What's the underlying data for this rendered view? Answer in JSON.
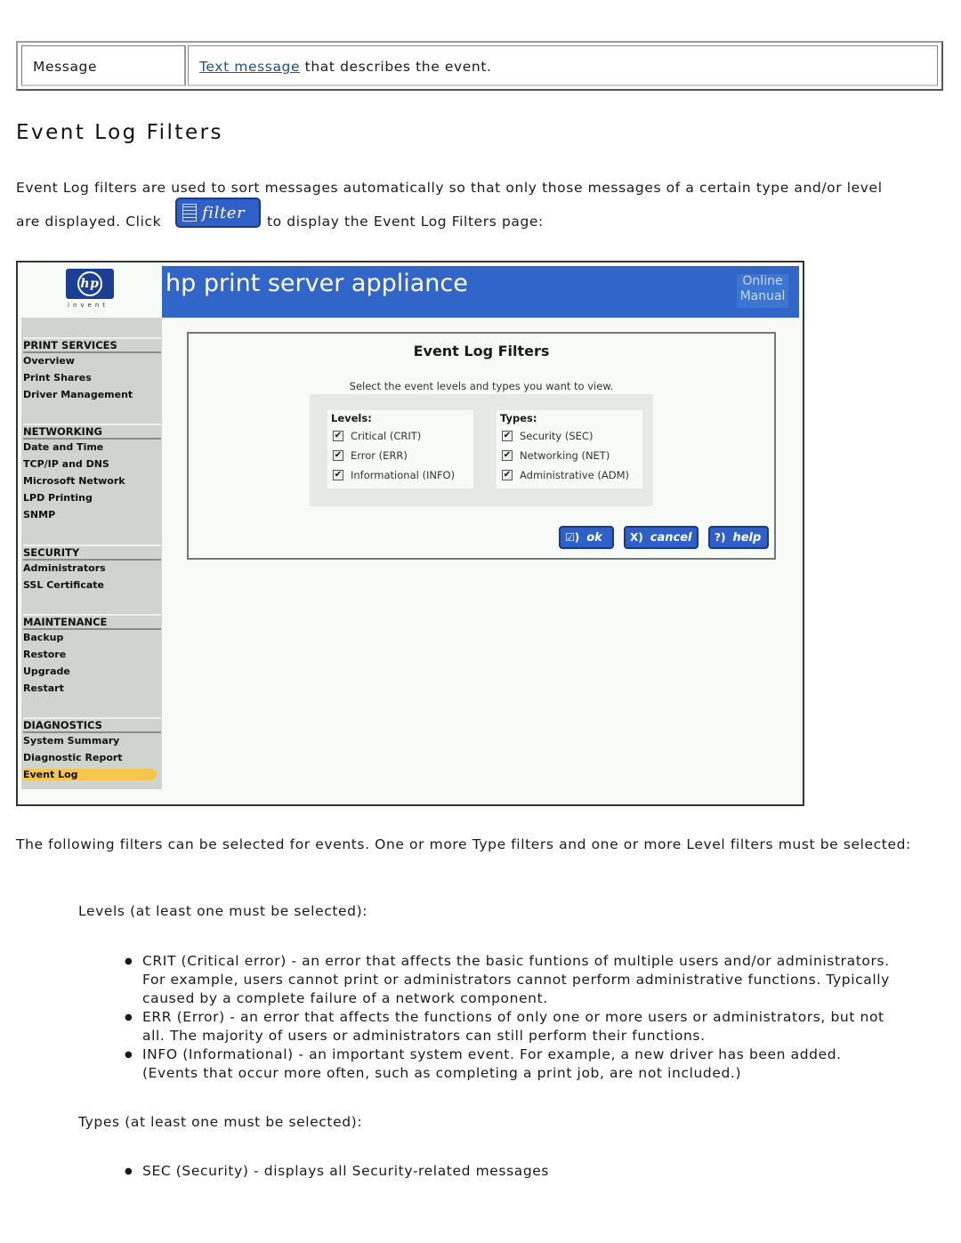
{
  "message_table": {
    "label": "Message",
    "link_text": "Text message",
    "description": " that describes the event."
  },
  "section_title": "Event Log Filters",
  "intro": {
    "line1": "Event Log filters are used to sort messages automatically so that only those messages of a certain type and/or level",
    "line2_before": "are displayed. Click",
    "filter_button_label": "filter",
    "line2_after": "to display the Event Log Filters page:"
  },
  "screenshot": {
    "logo_text": "hp",
    "logo_tagline": "invent",
    "banner_title": "hp print server appliance",
    "online_manual": "Online Manual",
    "sidebar": [
      {
        "heading": "PRINT SERVICES",
        "items": [
          "Overview",
          "Print Shares",
          "Driver Management"
        ]
      },
      {
        "heading": "NETWORKING",
        "items": [
          "Date and Time",
          "TCP/IP and DNS",
          "Microsoft Network",
          "LPD Printing",
          "SNMP"
        ]
      },
      {
        "heading": "SECURITY",
        "items": [
          "Administrators",
          "SSL Certificate"
        ]
      },
      {
        "heading": "MAINTENANCE",
        "items": [
          "Backup",
          "Restore",
          "Upgrade",
          "Restart"
        ]
      },
      {
        "heading": "DIAGNOSTICS",
        "items": [
          "System Summary",
          "Diagnostic Report",
          "Event Log"
        ]
      }
    ],
    "active_item": "Event Log",
    "panel_title": "Event Log Filters",
    "panel_subtitle": "Select the event levels and types you want to view.",
    "levels_title": "Levels:",
    "levels": [
      {
        "label": "Critical (CRIT)",
        "checked": true
      },
      {
        "label": "Error (ERR)",
        "checked": true
      },
      {
        "label": "Informational (INFO)",
        "checked": true
      }
    ],
    "types_title": "Types:",
    "types": [
      {
        "label": "Security (SEC)",
        "checked": true
      },
      {
        "label": "Networking (NET)",
        "checked": true
      },
      {
        "label": "Administrative (ADM)",
        "checked": true
      }
    ],
    "buttons": {
      "ok": "ok",
      "cancel": "cancel",
      "help": "help"
    }
  },
  "following": "The following filters can be selected for events. One or more Type filters and one or more Level filters must be selected:",
  "levels_label": "Levels (at least one must be selected):",
  "levels_bullets": [
    "CRIT (Critical error) - an error that affects the basic funtions of multiple users and/or administrators. For example, users cannot print or administrators cannot perform administrative functions. Typically caused by a complete failure of a network component.",
    "ERR (Error) - an error that affects the functions of only one or more users or administrators, but not all. The majority of users or administrators can still perform their functions.",
    "INFO (Informational) - an important system event. For example, a new driver has been added. (Events that occur more often, such as completing a print job, are not included.)"
  ],
  "types_label": "Types (at least one must be selected):",
  "types_bullets": [
    "SEC (Security) - displays all Security-related messages"
  ]
}
